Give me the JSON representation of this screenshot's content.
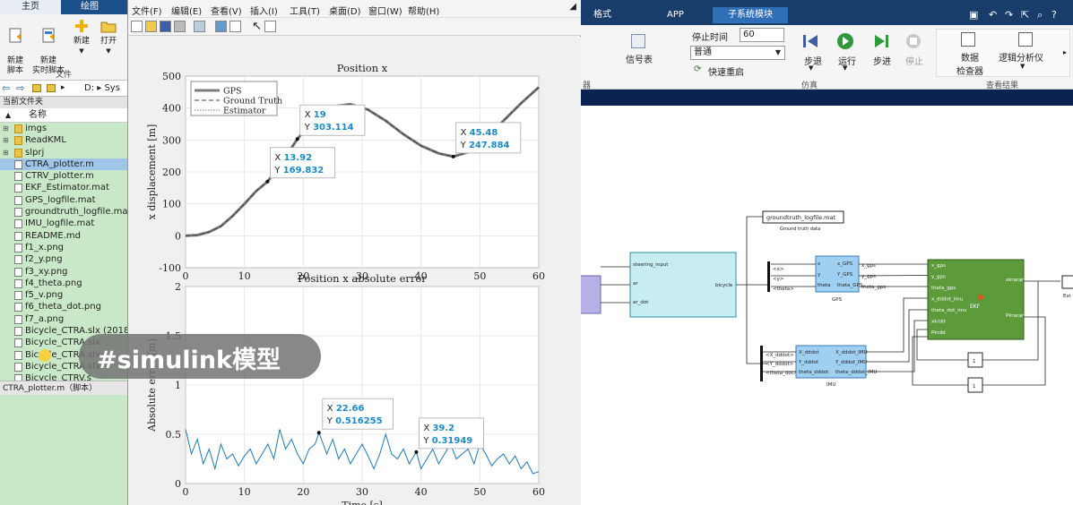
{
  "matlab": {
    "tabs": {
      "home": "主页",
      "plots": "绘图"
    },
    "toolstrip": {
      "new_script": "新建\n脚本",
      "new_live_script": "新建\n实时脚本",
      "new": "新建",
      "open": "打开",
      "group_label": "文件"
    },
    "address_path": "D: ▸ Sys",
    "current_folder_label": "当前文件夹",
    "name_column": "名称",
    "files": [
      {
        "name": "imgs",
        "type": "folder",
        "expandable": true
      },
      {
        "name": "ReadKML",
        "type": "folder",
        "expandable": true
      },
      {
        "name": "slprj",
        "type": "folder",
        "expandable": true
      },
      {
        "name": "CTRA_plotter.m",
        "type": "file",
        "selected": true
      },
      {
        "name": "CTRV_plotter.m",
        "type": "file"
      },
      {
        "name": "EKF_Estimator.mat",
        "type": "file"
      },
      {
        "name": "GPS_logfile.mat",
        "type": "file"
      },
      {
        "name": "groundtruth_logfile.mat",
        "type": "file"
      },
      {
        "name": "IMU_logfile.mat",
        "type": "file"
      },
      {
        "name": "README.md",
        "type": "file"
      },
      {
        "name": "f1_x.png",
        "type": "file"
      },
      {
        "name": "f2_y.png",
        "type": "file"
      },
      {
        "name": "f3_xy.png",
        "type": "file"
      },
      {
        "name": "f4_theta.png",
        "type": "file"
      },
      {
        "name": "f5_v.png",
        "type": "file"
      },
      {
        "name": "f6_theta_dot.png",
        "type": "file"
      },
      {
        "name": "f7_a.png",
        "type": "file"
      },
      {
        "name": "Bicycle_CTRA.slx (2018a",
        "type": "file"
      },
      {
        "name": "Bicycle_CTRA.slx",
        "type": "file"
      },
      {
        "name": "Bicycle_CTRA.slx",
        "type": "file"
      },
      {
        "name": "Bicycle_CTRA.slx",
        "type": "file"
      },
      {
        "name": "Bicycle_CTRV.s",
        "type": "file"
      }
    ],
    "details_label": "CTRA_plotter.m（脚本）"
  },
  "figure": {
    "menu": [
      "文件(F)",
      "编辑(E)",
      "查看(V)",
      "插入(I)",
      "工具(T)",
      "桌面(D)",
      "窗口(W)",
      "帮助(H)"
    ]
  },
  "chart_data": [
    {
      "type": "line",
      "title": "Position x",
      "ylabel": "x displacement [m]",
      "xlabel": "",
      "xlim": [
        0,
        60
      ],
      "ylim": [
        -100,
        500
      ],
      "xticks": [
        0,
        10,
        20,
        30,
        40,
        50,
        60
      ],
      "yticks": [
        -100,
        0,
        100,
        200,
        300,
        400,
        500
      ],
      "grid": true,
      "legend_position": "top-left",
      "legend": [
        "GPS",
        "Ground Truth",
        "Estimator"
      ],
      "x": [
        0,
        2,
        4,
        6,
        8,
        10,
        12,
        13.92,
        16,
        19,
        22,
        25,
        28,
        31,
        34,
        37,
        40,
        43,
        45.48,
        48,
        51,
        54,
        57,
        60
      ],
      "y": [
        0,
        2,
        12,
        30,
        62,
        100,
        140,
        169.832,
        220,
        303.114,
        370,
        405,
        412,
        395,
        360,
        318,
        282,
        258,
        247.884,
        262,
        305,
        360,
        415,
        465
      ],
      "datatips": [
        {
          "x": 13.92,
          "y": 169.832,
          "x_label": "13.92",
          "y_label": "169.832"
        },
        {
          "x": 19,
          "y": 303.114,
          "x_label": "19",
          "y_label": "303.114"
        },
        {
          "x": 45.48,
          "y": 247.884,
          "x_label": "45.48",
          "y_label": "247.884"
        }
      ],
      "colors": {
        "gps": "#7c7c7c",
        "truth": "#444444",
        "estimator": "#444444"
      }
    },
    {
      "type": "line",
      "title": "Position x absolute error",
      "ylabel": "Absolute error [m]",
      "xlabel": "Time [s]",
      "xlim": [
        0,
        60
      ],
      "ylim": [
        0,
        2
      ],
      "xticks": [
        0,
        10,
        20,
        30,
        40,
        50,
        60
      ],
      "yticks": [
        0,
        0.5,
        1,
        1.5,
        2
      ],
      "grid": true,
      "x": [
        0,
        1,
        2,
        3,
        4,
        5,
        6,
        7,
        8,
        9,
        10,
        11,
        12,
        13,
        14,
        15,
        16,
        17,
        18,
        19,
        20,
        21,
        22,
        22.66,
        24,
        25,
        26,
        27,
        28,
        29,
        30,
        31,
        32,
        33,
        34,
        35,
        36,
        37,
        38,
        39.2,
        40,
        41,
        42,
        43,
        44,
        45,
        46,
        47,
        48,
        49,
        50,
        51,
        52,
        53,
        54,
        55,
        56,
        57,
        58,
        59,
        60
      ],
      "y": [
        0.55,
        0.3,
        0.45,
        0.2,
        0.35,
        0.15,
        0.4,
        0.25,
        0.3,
        0.18,
        0.28,
        0.35,
        0.2,
        0.3,
        0.4,
        0.25,
        0.55,
        0.35,
        0.45,
        0.3,
        0.2,
        0.35,
        0.4,
        0.516255,
        0.3,
        0.45,
        0.25,
        0.35,
        0.2,
        0.3,
        0.4,
        0.28,
        0.15,
        0.3,
        0.5,
        0.3,
        0.25,
        0.35,
        0.2,
        0.31949,
        0.15,
        0.25,
        0.35,
        0.2,
        0.3,
        0.4,
        0.25,
        0.3,
        0.35,
        0.2,
        0.4,
        0.3,
        0.18,
        0.25,
        0.3,
        0.2,
        0.28,
        0.15,
        0.22,
        0.1,
        0.12
      ],
      "datatips": [
        {
          "x": 22.66,
          "y": 0.516255,
          "x_label": "22.66",
          "y_label": "0.516255"
        },
        {
          "x": 39.2,
          "y": 0.31949,
          "x_label": "39.2",
          "y_label": "0.31949"
        }
      ],
      "colors": {
        "line": "#1f77b4"
      }
    }
  ],
  "simulink": {
    "tabs": [
      "格式",
      "APP",
      "子系统模块"
    ],
    "ribbon": {
      "data_label": "信号表",
      "stop_time_label": "停止时间",
      "stop_time_value": "60",
      "mode_value": "普通",
      "fast_restart": "快速重启",
      "step_back": "步退",
      "run": "运行",
      "step_forward": "步进",
      "stop": "停止",
      "data_inspector": "数据\n检查器",
      "logic_analyzer": "逻辑分析仪",
      "section_sim": "仿真",
      "section_review": "查看结果",
      "section_left": "器"
    },
    "blocks": {
      "to_file": "groundtruth_logfile.mat",
      "to_file_caption": "Ground truth data",
      "bicycle_ports_in": [
        "steering_input",
        "ar",
        "ar_dot"
      ],
      "bicycle_port_out": "bicycle",
      "bus_labels_top": [
        "<x>",
        "<y>",
        "<theta>"
      ],
      "gps_in": [
        "x",
        "y",
        "theta"
      ],
      "gps_out": [
        "x_GPS",
        "Y_GPS",
        "theta_GPS"
      ],
      "gps_name": "GPS",
      "gps_signals": [
        "x_gps",
        "y_gps",
        "theta_gps"
      ],
      "bus_labels_bottom": [
        "<X_dddot>",
        "<Y_dddot>",
        "<theta_dot>"
      ],
      "imu_in": [
        "X_dddot",
        "Y_dddot",
        "theta_dddot"
      ],
      "imu_out": [
        "X_dddot_IMU",
        "Y_dddot_IMU",
        "theta_dddot_IMU"
      ],
      "imu_name": "IMU",
      "ekf_in": [
        "x_gps",
        "y_gps",
        "theta_gps",
        "x_dddot_imu",
        "theta_dot_imu",
        "xkrdd",
        "Pkrdd"
      ],
      "ekf_out": [
        "xkrarar",
        "Pkrarar"
      ],
      "ekf_name": "EKF",
      "out_label": "Est"
    }
  },
  "caption": "#simulink模型"
}
